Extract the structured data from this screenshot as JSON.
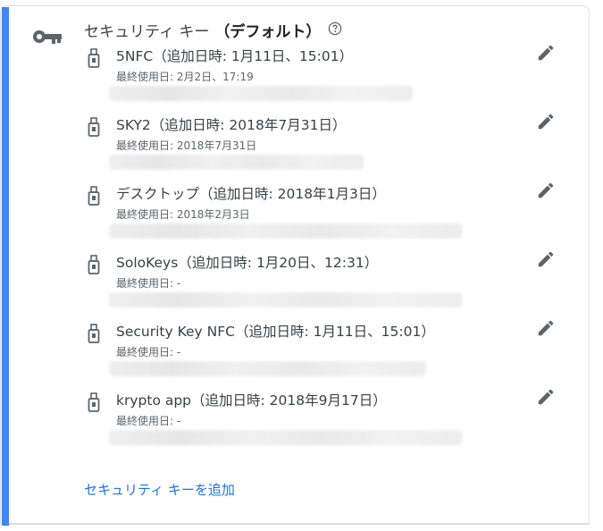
{
  "section": {
    "title": "セキュリティ キー",
    "default_label": "（デフォルト）",
    "help_icon": "help-circle-icon",
    "key_icon": "key-icon"
  },
  "keys": [
    {
      "name": "5NFC（追加日時: 1月11日、15:01）",
      "last_used": "最終使用日: 2月2日、17:19"
    },
    {
      "name": "SKY2（追加日時: 2018年7月31日）",
      "last_used": "最終使用日: 2018年7月31日"
    },
    {
      "name": "デスクトップ（追加日時: 2018年1月3日）",
      "last_used": "最終使用日: 2018年2月3日"
    },
    {
      "name": "SoloKeys（追加日時: 1月20日、12:31）",
      "last_used": "最終使用日: -"
    },
    {
      "name": "Security Key NFC（追加日時: 1月11日、15:01）",
      "last_used": "最終使用日: -"
    },
    {
      "name": "krypto app（追加日時: 2018年9月17日）",
      "last_used": "最終使用日: -"
    }
  ],
  "add_link": "セキュリティ キーを追加",
  "colors": {
    "accent": "#4285f4",
    "link": "#1a73e8",
    "icon": "#5f6368"
  }
}
